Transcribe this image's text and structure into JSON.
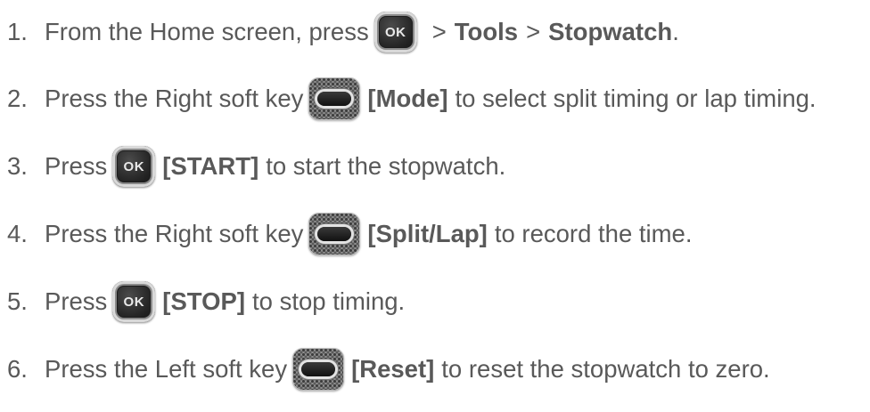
{
  "steps": [
    {
      "number": "1.",
      "pre": "From the Home screen, press",
      "key": "ok",
      "ok_label": "OK",
      "sep1": ">",
      "item1": "Tools",
      "sep2": ">",
      "item2": "Stopwatch",
      "end": "."
    },
    {
      "number": "2.",
      "pre": "Press the Right soft key",
      "key": "soft-key",
      "bold": "[Mode]",
      "post": "to select split timing or lap timing."
    },
    {
      "number": "3.",
      "pre": "Press",
      "key": "ok",
      "ok_label": "OK",
      "bold": "[START]",
      "post": "to start the stopwatch."
    },
    {
      "number": "4.",
      "pre": "Press the Right soft key",
      "key": "soft-key",
      "bold": "[Split/Lap]",
      "post": "to record the time."
    },
    {
      "number": "5.",
      "pre": "Press",
      "key": "ok",
      "ok_label": "OK",
      "bold": "[STOP]",
      "post": "to stop timing."
    },
    {
      "number": "6.",
      "pre": "Press the Left soft key",
      "key": "soft-key",
      "bold": "[Reset]",
      "post": "to reset the stopwatch to zero."
    }
  ]
}
